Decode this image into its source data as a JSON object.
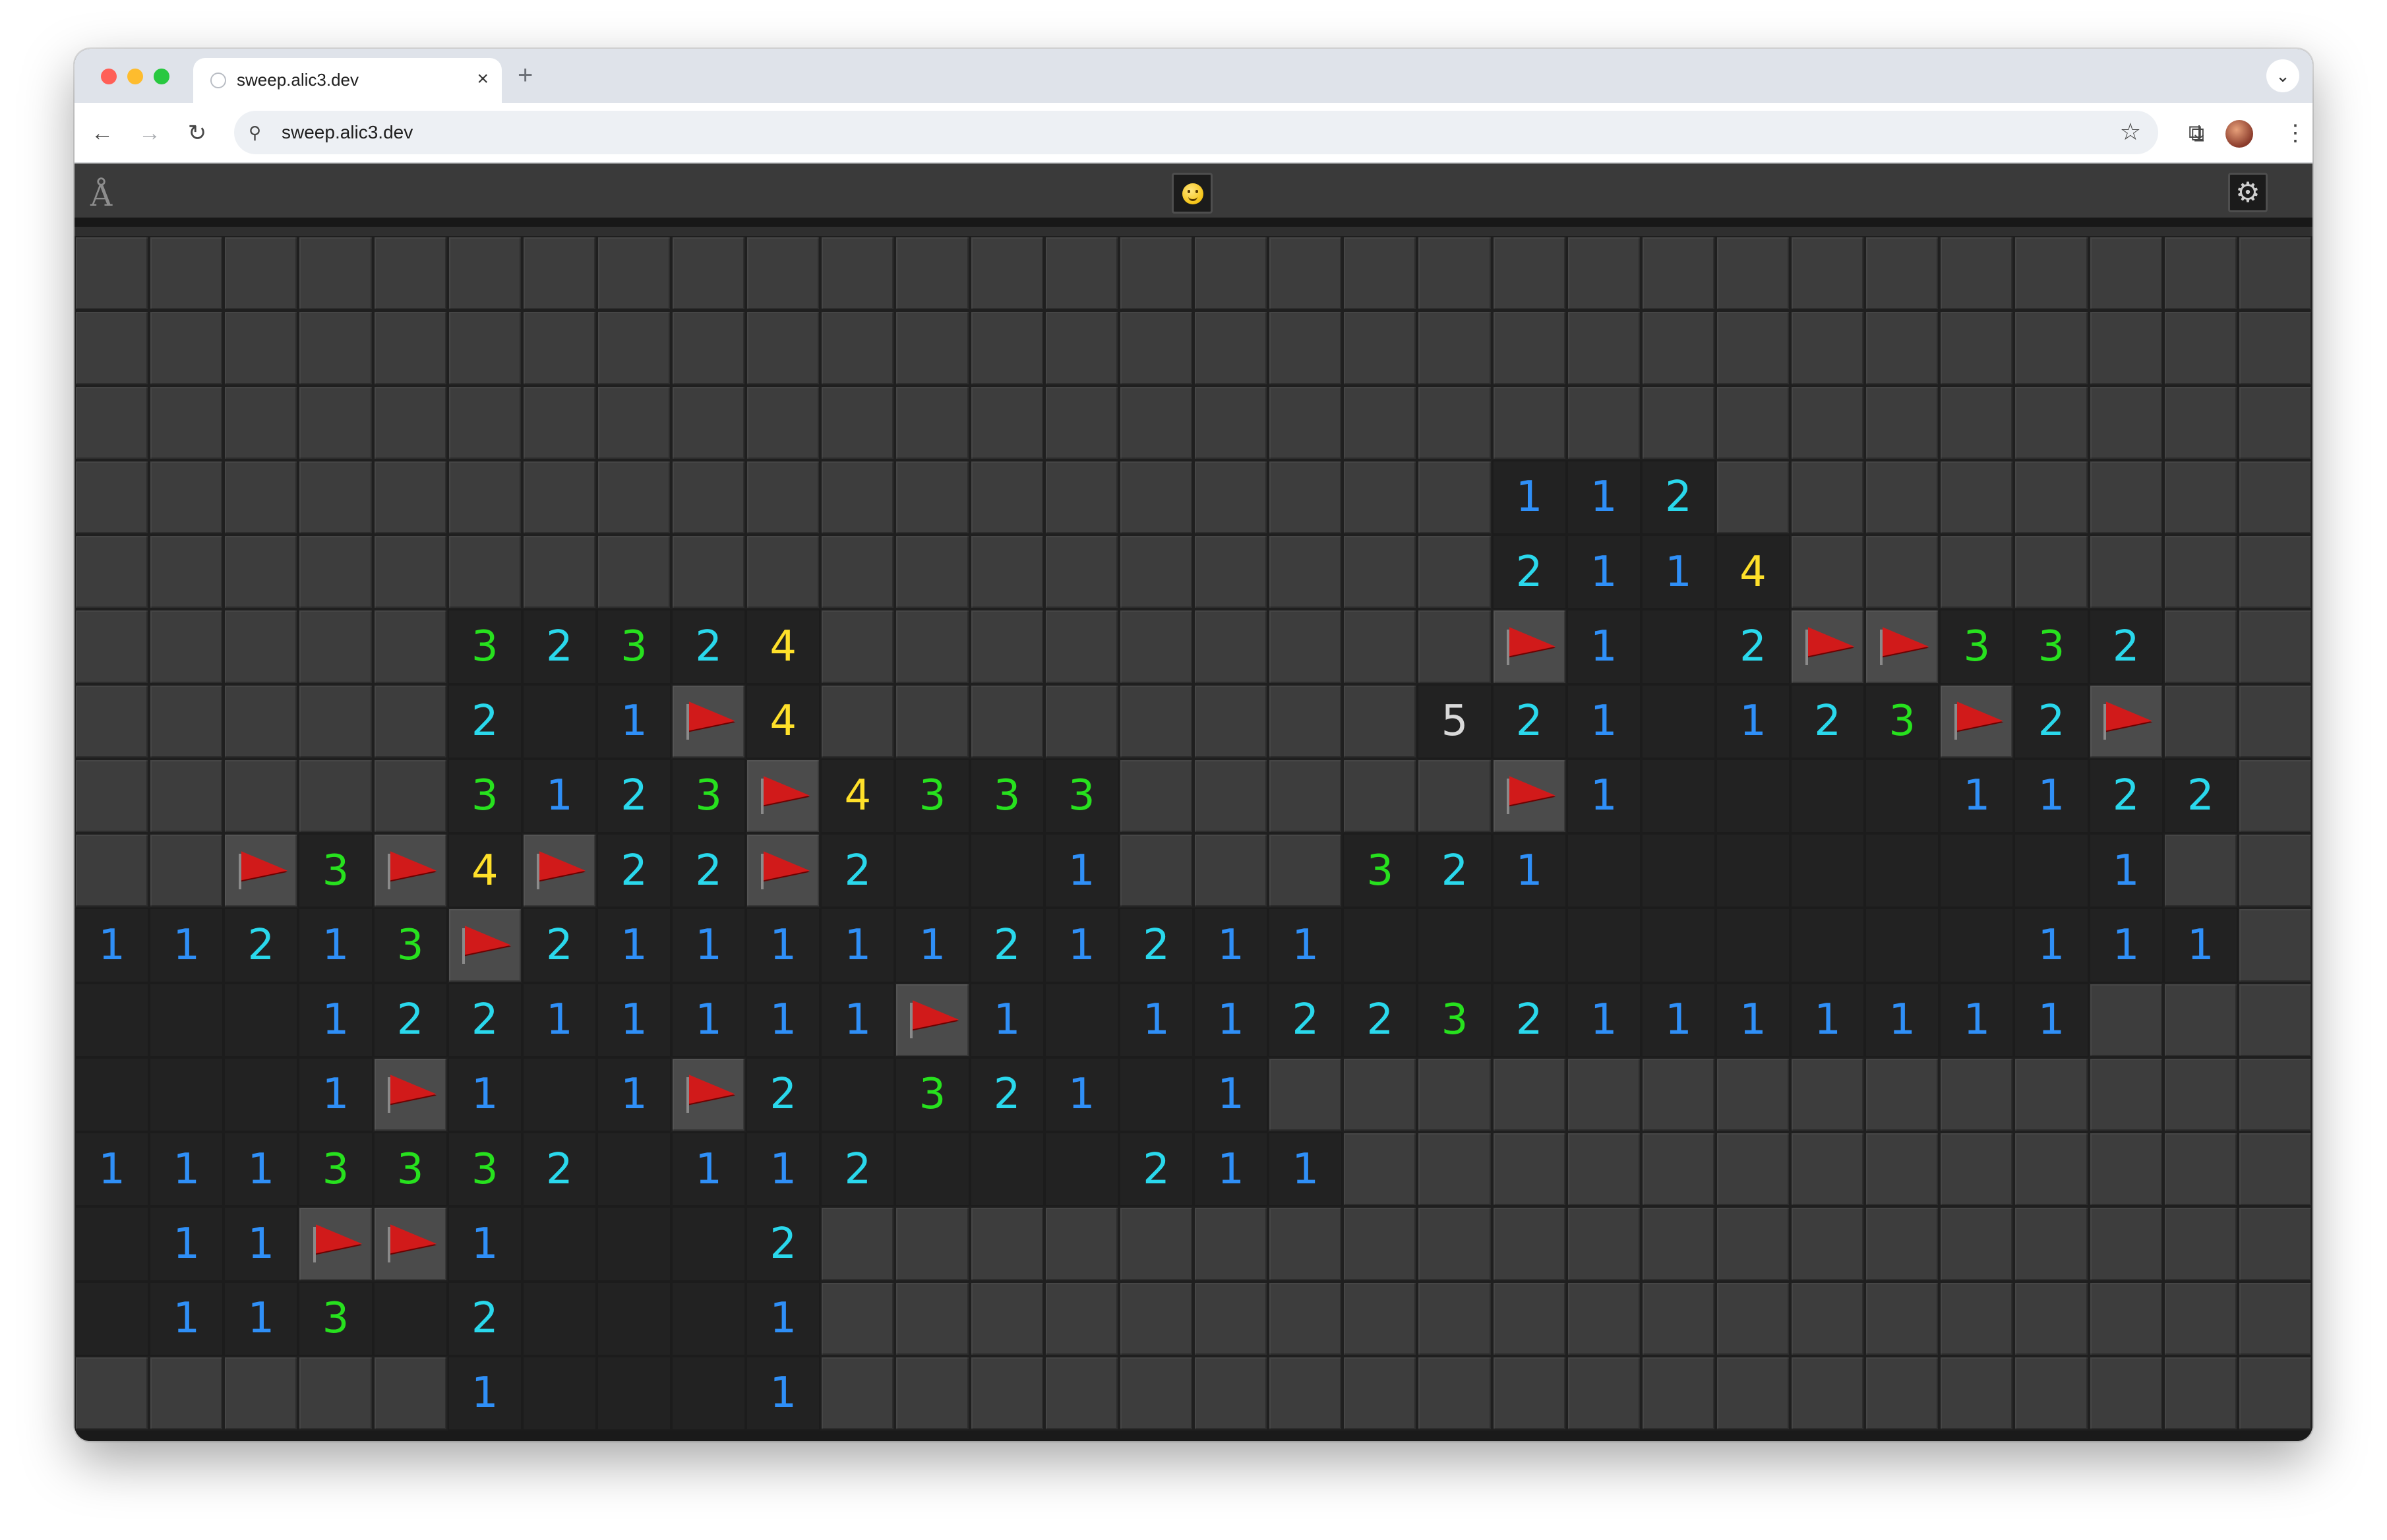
{
  "browser": {
    "tab_title": "sweep.alic3.dev",
    "tab_close": "×",
    "new_tab": "+",
    "tab_menu": "⌄",
    "url": "sweep.alic3.dev",
    "icons": {
      "back": "back-arrow-icon",
      "forward": "forward-arrow-icon",
      "reload": "reload-icon",
      "site_info": "tune-icon",
      "bookmark": "star-icon",
      "extensions": "puzzle-icon",
      "download": "download-icon",
      "menu": "kebab-menu-icon"
    }
  },
  "game": {
    "logo_icon": "alic3-logo-icon",
    "face_icon": "smiley-face-icon",
    "settings_icon": "gear-icon",
    "columns": 30,
    "rows": 16,
    "legend": {
      "hidden": "hidden tile",
      "open": "revealed empty",
      "F": "flag",
      "digits": "adjacent mine count"
    },
    "number_colors": {
      "1": "#2f8ff7",
      "2": "#2ad8ec",
      "3": "#27e11e",
      "4": "#ffe02a",
      "5": "#d9d9d9"
    },
    "grid": [
      "..............................",
      "..............................",
      "..............................",
      "...................112........",
      "...................2114.......",
      ".....32324.........F1_2FF332..",
      ".....2_1F4........521_123F2F..",
      ".....3123F4333.....F1____1122..",
      "..F3F4F22F2__1...321_______1..",
      "11213F21111121211_________111.",
      "___12211111F1_1122321111111....",
      "___1F1_1F2_321_1.............",
      "1113332_112___211.............",
      "_11FF1___2....................",
      "_113_2___1....................",
      ".....1___1...................."
    ]
  }
}
